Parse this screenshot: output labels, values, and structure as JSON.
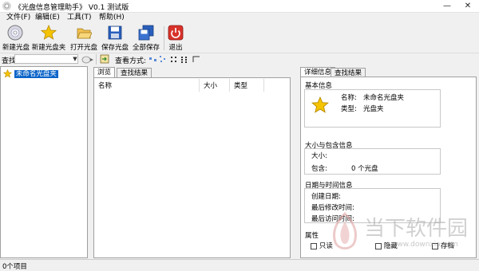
{
  "window": {
    "title": "《光盘信息管理助手》 V0.1 测试版",
    "minimize": "—",
    "close": "✕"
  },
  "menu": [
    "文件(F)",
    "编辑(E)",
    "工具(T)",
    "帮助(H)"
  ],
  "toolbar": {
    "buttons": [
      "新建光盘",
      "新建光盘夹",
      "打开光盘",
      "保存光盘",
      "全部保存",
      "退出"
    ]
  },
  "searchbar": {
    "label": "查找",
    "view_label": "查看方式:"
  },
  "tree": {
    "root_label": "未命名光盘夹"
  },
  "center_tabs": [
    "浏览",
    "查找结果"
  ],
  "list_columns": [
    "名称",
    "大小",
    "类型"
  ],
  "right_tabs": [
    "详细信息",
    "查找结果"
  ],
  "details": {
    "basic": {
      "title": "基本信息",
      "name_label": "名称:",
      "name_value": "未命名光盘夹",
      "type_label": "类型:",
      "type_value": "光盘夹"
    },
    "size": {
      "title": "大小与包含信息",
      "size_label": "大小:",
      "size_value": "",
      "contains_label": "包含:",
      "contains_value": "0 个光盘"
    },
    "dates": {
      "title": "日期与时间信息",
      "created_label": "创建日期:",
      "modified_label": "最后修改时间:",
      "accessed_label": "最后访问时间:"
    },
    "attrs": {
      "title": "属性",
      "readonly": "只读",
      "hidden": "隐藏",
      "archive": "存档"
    }
  },
  "status": {
    "text": "0个项目"
  },
  "watermark": {
    "brand": "当下软件园",
    "url": "www.downxia.com"
  },
  "colors": {
    "selection": "#0a64c8",
    "star": "#f5c400",
    "exit_red": "#d8322a",
    "disk_blue": "#2a5fbd"
  }
}
